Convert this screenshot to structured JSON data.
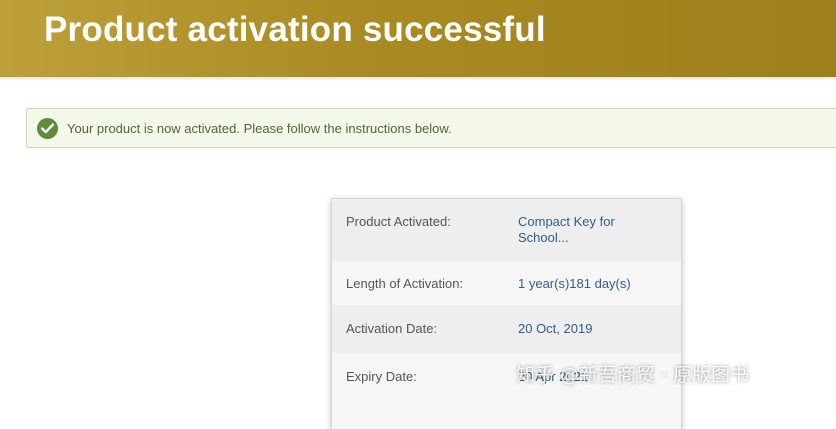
{
  "header": {
    "title": "Product activation successful"
  },
  "alert": {
    "icon": "check-circle-icon",
    "message": "Your product is now activated. Please follow the instructions below."
  },
  "details": {
    "rows": [
      {
        "label": "Product Activated:",
        "value": "Compact Key for School..."
      },
      {
        "label": "Length of Activation:",
        "value": "1 year(s)181 day(s)"
      },
      {
        "label": "Activation Date:",
        "value": "20 Oct, 2019"
      },
      {
        "label": "Expiry Date:",
        "value": "20 Apr 2021"
      }
    ]
  },
  "watermark": {
    "text": "知乎 @新吾商贸 · 原版图书"
  },
  "colors": {
    "header_bg": "#a98a22",
    "success_green": "#5e8d3a",
    "link_blue": "#2f5f8a"
  }
}
